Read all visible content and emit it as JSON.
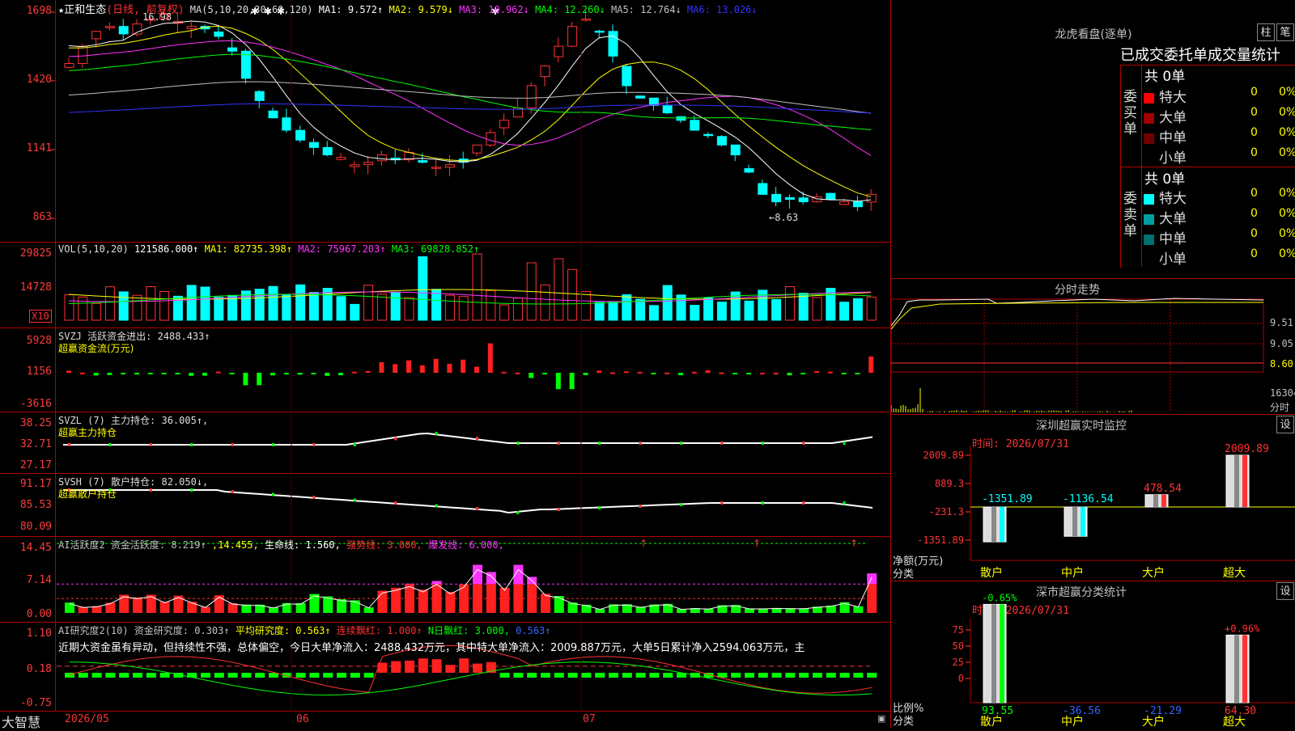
{
  "app": {
    "brand": "大智慧"
  },
  "stock": {
    "name": "正和生态",
    "period": "(日线, 前复权)"
  },
  "ma_legend": {
    "label": "MA(5,10,20,30,60,120)",
    "items": [
      {
        "text": "MA1: 9.572↑",
        "color": "#ffffff"
      },
      {
        "text": "MA2: 9.579↓",
        "color": "#ffff00"
      },
      {
        "text": "MA3: 10.962↓",
        "color": "#ff33ff"
      },
      {
        "text": "MA4: 12.260↓",
        "color": "#00ff00"
      },
      {
        "text": "MA5: 12.764↓",
        "color": "#c0c0c0"
      },
      {
        "text": "MA6: 13.026↓",
        "color": "#3333ff"
      }
    ]
  },
  "price_panel": {
    "yticks": [
      {
        "label": "1698",
        "v": 16.98
      },
      {
        "label": "1420",
        "v": 14.2
      },
      {
        "label": "1141",
        "v": 11.41
      },
      {
        "label": "863",
        "v": 8.63
      }
    ],
    "high_label": "16.98",
    "low_label": "←8.63"
  },
  "vol_panel": {
    "title": "VOL(5,10,20)",
    "items": [
      {
        "text": "121586.000↑",
        "color": "#ffffff"
      },
      {
        "text": "MA1: 82735.398↑",
        "color": "#ffff00"
      },
      {
        "text": "MA2: 75967.203↑",
        "color": "#ff33ff"
      },
      {
        "text": "MA3: 69828.852↑",
        "color": "#00ff00"
      }
    ],
    "yticks": [
      "29825",
      "14728"
    ],
    "unit": "X10"
  },
  "svzj_panel": {
    "title": "SVZJ  活跃资金进出: 2488.433↑",
    "subtitle": "超赢资金流(万元)",
    "yticks": [
      "5928",
      "1156",
      "-3616"
    ]
  },
  "svzl_panel": {
    "title": "SVZL (7) 主力持仓: 36.005↑,",
    "subtitle": "超赢主力持仓",
    "yticks": [
      "38.25",
      "32.71",
      "27.17"
    ]
  },
  "svsh_panel": {
    "title": "SVSH (7) 散户持仓: 82.050↓,",
    "subtitle": "超赢散户持仓",
    "yticks": [
      "91.17",
      "85.53",
      "80.09"
    ]
  },
  "ai2_panel": {
    "items": [
      {
        "text": "AI活跃度2 资金活跃度: 8.219↑",
        "color": "#c0c0c0"
      },
      {
        "text": ",14.455,",
        "color": "#ffff00"
      },
      {
        "text": "生命线: 1.560,",
        "color": "#ffffff"
      },
      {
        "text": "强势线: 3.000,",
        "color": "#ff3333"
      },
      {
        "text": "爆发线: 6.000,",
        "color": "#ff33ff"
      }
    ],
    "yticks": [
      "14.45",
      "7.14",
      "0.00"
    ]
  },
  "ai_research_panel": {
    "items": [
      {
        "text": "AI研究度2(10) 资金研究度: 0.303↑",
        "color": "#c0c0c0"
      },
      {
        "text": "平均研究度: 0.563↑",
        "color": "#ffff00"
      },
      {
        "text": "连续飘红: 1.000↑",
        "color": "#ff3333"
      },
      {
        "text": "N日飘红: 3.000,",
        "color": "#00ff00"
      },
      {
        "text": "0.563↑",
        "color": "#3366ff"
      }
    ],
    "comment": "近期大资金虽有异动，但持续性不强，总体偏空，今日大单净流入：2488.432万元，其中特大单净流入：2009.887万元，大单5日累计净入2594.063万元，主",
    "yticks": [
      "1.10",
      "0.18",
      "-0.75"
    ]
  },
  "xaxis": {
    "labels": [
      "2026/05",
      "06",
      "07"
    ]
  },
  "dragon": {
    "title": "龙虎看盘(逐单)",
    "btn1": "柱",
    "btn2": "笔",
    "heading": "已成交委托单成交量统计",
    "buy_label": "委买单",
    "sell_label": "委卖单",
    "buy_total": "共 0单",
    "sell_total": "共 0单",
    "buy_rows": [
      {
        "name": "特大",
        "qty": "0",
        "pct": "0%",
        "color": "#ff0000"
      },
      {
        "name": "大单",
        "qty": "0",
        "pct": "0%",
        "color": "#a00000"
      },
      {
        "name": "中单",
        "qty": "0",
        "pct": "0%",
        "color": "#700000"
      },
      {
        "name": "小单",
        "qty": "0",
        "pct": "0%",
        "color": "#000000"
      }
    ],
    "sell_rows": [
      {
        "name": "特大",
        "qty": "0",
        "pct": "0%",
        "color": "#00ffff"
      },
      {
        "name": "大单",
        "qty": "0",
        "pct": "0%",
        "color": "#00a0a0"
      },
      {
        "name": "中单",
        "qty": "0",
        "pct": "0%",
        "color": "#007070"
      },
      {
        "name": "小单",
        "qty": "0",
        "pct": "0%",
        "color": "#000000"
      }
    ]
  },
  "intraday": {
    "title": "分时走势",
    "yticks": [
      "9.51",
      "9.05",
      "8.60"
    ],
    "vol_tick": "16304",
    "vol_label": "分时"
  },
  "sz_monitor": {
    "title": "深圳超赢实时监控",
    "settings": "设",
    "time": "时间: 2026/07/31",
    "yticks": [
      "2009.89",
      "889.3",
      "-231.3",
      "-1351.89"
    ],
    "ylabel": "净额(万元)",
    "xlabel": "分类",
    "chart_data": {
      "type": "bar",
      "categories": [
        "散户",
        "中户",
        "大户",
        "超大"
      ],
      "values": [
        -1351.89,
        -1136.54,
        478.54,
        2009.89
      ],
      "value_labels": [
        "-1351.89",
        "-1136.54",
        "478.54",
        "2009.89"
      ],
      "ylim": [
        -1351.89,
        2009.89
      ]
    }
  },
  "sz_class": {
    "title": "深市超赢分类统计",
    "settings": "设",
    "time": "时间: 2026/07/31",
    "yticks": [
      "75",
      "50",
      "25",
      "0"
    ],
    "ylabel": "比例%",
    "xlabel": "分类",
    "chart_data": {
      "type": "bar",
      "categories": [
        "散户",
        "中户",
        "大户",
        "超大"
      ],
      "values": [
        93.55,
        -36.56,
        -21.29,
        64.3
      ],
      "value_labels": [
        "93.55",
        "-36.56",
        "-21.29",
        "64.30"
      ],
      "change_labels": [
        "-0.65%",
        "",
        "",
        "+0.96%"
      ],
      "ylim": [
        0,
        100
      ]
    }
  }
}
